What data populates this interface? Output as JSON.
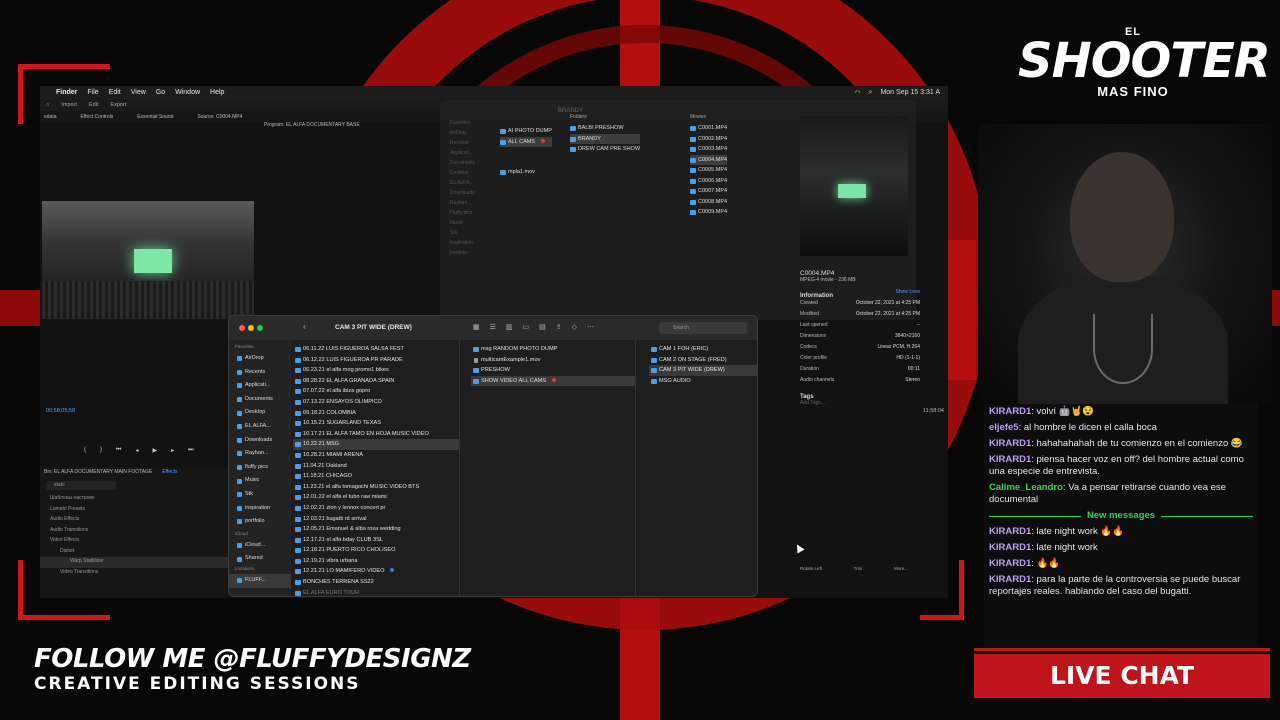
{
  "brand": {
    "top": "EL",
    "name": "SHOOTER",
    "sub": "MAS FINO"
  },
  "follow": {
    "line1": "FOLLOW ME @FLUFFYDESIGNZ",
    "line2": "CREATIVE EDITING SESSIONS"
  },
  "livechat_label": "LIVE CHAT",
  "colors": {
    "accent_red": "#c0141a",
    "chat_green": "#2fd35a",
    "finder_blue": "#4a9eea"
  },
  "menubar": {
    "app": "Finder",
    "items": [
      "File",
      "Edit",
      "View",
      "Go",
      "Window",
      "Help"
    ],
    "clock": "Mon Sep 15 3:31 A"
  },
  "premiere": {
    "top_items": [
      "Import",
      "Edit",
      "Export"
    ],
    "tabs": [
      "edata",
      "Effect Controls",
      "Essential Sound",
      "Source: C0004.MP4"
    ],
    "program": "Program: EL ALFA DOCUMENTARY BASE",
    "timecode": "00;58;05;58",
    "right_time": "11;58:04",
    "timeline_label": "Bin: EL ALFA DOCUMENTARY MAIN FOOTAGE",
    "effects_tab": "Effects",
    "search_value": "stabi",
    "effects_tree": [
      "Шаблоны настроек",
      "Lumetri Presets",
      "Audio Effects",
      "Audio Transitions",
      "Video Effects",
      "Distort",
      "Warp Stabilizer",
      "Video Transitions"
    ]
  },
  "finder_back": {
    "title": "BRANDY",
    "sidebar": [
      "Favorites",
      "AirDrop",
      "Recents",
      "Applicati...",
      "Documents",
      "Desktop",
      "EL ALFA...",
      "Downloads",
      "Rayban...",
      "Fluffy pics",
      "Music",
      "Stk",
      "inspiration",
      "portfolio"
    ],
    "col1": [
      "AI PHOTO DUMP",
      "ALL CAMS",
      "mpla1.mov"
    ],
    "folders_header": "Folders",
    "folders": [
      "BALBI PRESHOW",
      "BRANDY",
      "DREW CAM PRE SHOW"
    ],
    "movies_header": "Movies",
    "movies": [
      "C0001.MP4",
      "C0002.MP4",
      "C0003.MP4",
      "C0004.MP4",
      "C0005.MP4",
      "C0006.MP4",
      "C0007.MP4",
      "C0008.MP4",
      "C0009.MP4"
    ]
  },
  "inspector": {
    "filename": "C0004.MP4",
    "kind": "MPEG-4 movie - 236 MB",
    "info_label": "Information",
    "show_less": "Show Less",
    "rows": [
      {
        "k": "Created",
        "v": "October 22, 2021 at 4:25 PM"
      },
      {
        "k": "Modified",
        "v": "October 22, 2021 at 4:25 PM"
      },
      {
        "k": "Last opened",
        "v": "--"
      },
      {
        "k": "Dimensions",
        "v": "3840×2160"
      },
      {
        "k": "Codecs",
        "v": "Linear PCM, H.264"
      },
      {
        "k": "Color profile",
        "v": "HD (1-1-1)"
      },
      {
        "k": "Duration",
        "v": "00:11"
      },
      {
        "k": "Audio channels",
        "v": "Stereo"
      }
    ],
    "tags_label": "Tags",
    "tags_placeholder": "Add Tags...",
    "actions": [
      "Rotate Left",
      "Trim",
      "More..."
    ]
  },
  "finder_front": {
    "title": "CAM 3 PIT WIDE (DREW)",
    "search_placeholder": "Search",
    "sidebar_fav": "Favorites",
    "sidebar": [
      "AirDrop",
      "Recents",
      "Applicati...",
      "Documents",
      "Desktop",
      "EL ALFA...",
      "Downloads",
      "Rayban...",
      "fluffy pics",
      "Music",
      "Stk",
      "inspiration",
      "portfolio"
    ],
    "icloud_hdr": "iCloud",
    "icloud": [
      "iCloud...",
      "Shared"
    ],
    "locations_hdr": "Locations",
    "locations": [
      "FLUFF..."
    ],
    "col1": [
      "06.11.22 LUIS FIGUEROA SALSA FEST",
      "06.12.22 LUIS FIGUEROA PR PARADE",
      "06.23.21 el alfa mog promo1 bikes",
      "08.28.22 EL ALFA GRANADA SPAIN",
      "07.07.22 el alfa ibiza gopro",
      "07.13.22 ENSAYOS OLIMPICO",
      "09.18.21 COLOMBIA",
      "10.15.21 SUGARLAND TEXAS",
      "10.17.21 EL ALFA TAMO EN HOJA MUSIC VIDEO",
      "10.22.21 MSG",
      "10.28.21 MIAMI ARENA",
      "11.04.21 Oakland",
      "11.18.21 CHICAGO",
      "11.23.21 el alfa tomagochi MUSIC VIDEO BTS",
      "12.01.22 el alfa el tubo raw miami",
      "12.02.21 zion y lennox concert pr",
      "12.03.21 bugatti rd arrival",
      "12.05.21 Emanuel & alba rosa wedding",
      "12.17.21 el alfa bday CLUB 3SL",
      "12.18.21 PUERTO RICO CHOLISEO",
      "12.19.21 vibra urbana",
      "12.21.21 LO MAMIFERO VIDEO",
      "BONCHES TERRENA SS22",
      "EL ALFA EURO TOUR"
    ],
    "col2": [
      "msg RANDOM PHOTO DUMP",
      "multicamExample1.mov",
      "PRESHOW",
      "SHOW VIDEO ALL CAMS"
    ],
    "col3": [
      "CAM 1 FOH (ERIC)",
      "CAM 2 ON STAGE (FRED)",
      "CAM 3 PIT WIDE (DREW)",
      "MSG AUDIO"
    ]
  },
  "chat": [
    {
      "user": "KIRARD1",
      "color": "#c49bff",
      "text": "volví 🤖🤘😵"
    },
    {
      "user": "eljefe5",
      "color": "#c49bff",
      "text": "al hombre le dicen el calla boca"
    },
    {
      "user": "KIRARD1",
      "color": "#c49bff",
      "text": "hahahahahah de tu comienzo en el comienzo 😂"
    },
    {
      "user": "KIRARD1",
      "color": "#c49bff",
      "text": "piensa hacer voz en off? del hombre actual como una especie de entrevista."
    },
    {
      "user": "Callme_Leandro",
      "color": "#39d353",
      "text": "Va a pensar retirarse cuando vea ese documental"
    },
    {
      "user": "KIRARD1",
      "color": "#c49bff",
      "text": "late night work 🔥🔥"
    },
    {
      "user": "KIRARD1",
      "color": "#c49bff",
      "text": "late night work"
    },
    {
      "user": "KIRARD1",
      "color": "#c49bff",
      "text": "🔥🔥"
    },
    {
      "user": "KIRARD1",
      "color": "#c49bff",
      "text": "para la parte de la controversia se puede buscar reportajes reales. hablando del caso del bugatti."
    }
  ],
  "new_messages_label": "New messages"
}
